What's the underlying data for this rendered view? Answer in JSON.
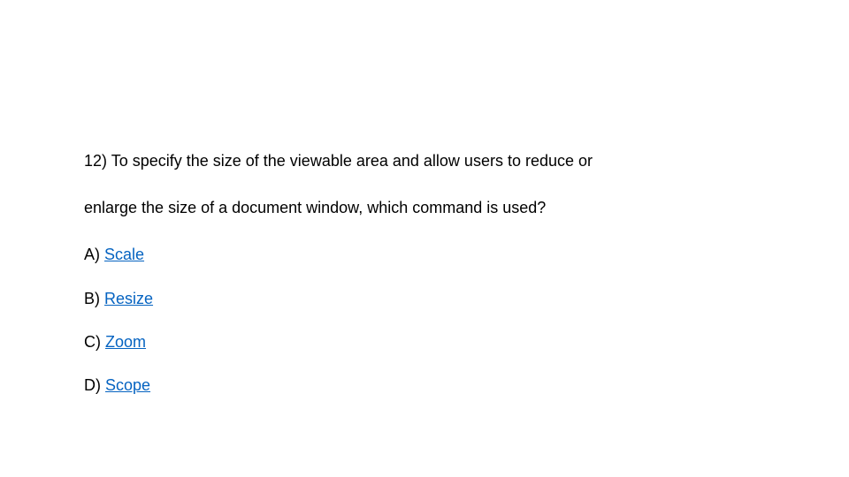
{
  "question": {
    "number": "12)",
    "line1": "To specify the size of the viewable area and allow users to reduce or",
    "line2": "enlarge the size of a document window, which command is used?"
  },
  "options": {
    "a": {
      "letter": "A)",
      "text": "Scale"
    },
    "b": {
      "letter": "B)",
      "text": "Resize"
    },
    "c": {
      "letter": "C)",
      "text": "Zoom"
    },
    "d": {
      "letter": "D)",
      "text": "Scope"
    }
  }
}
